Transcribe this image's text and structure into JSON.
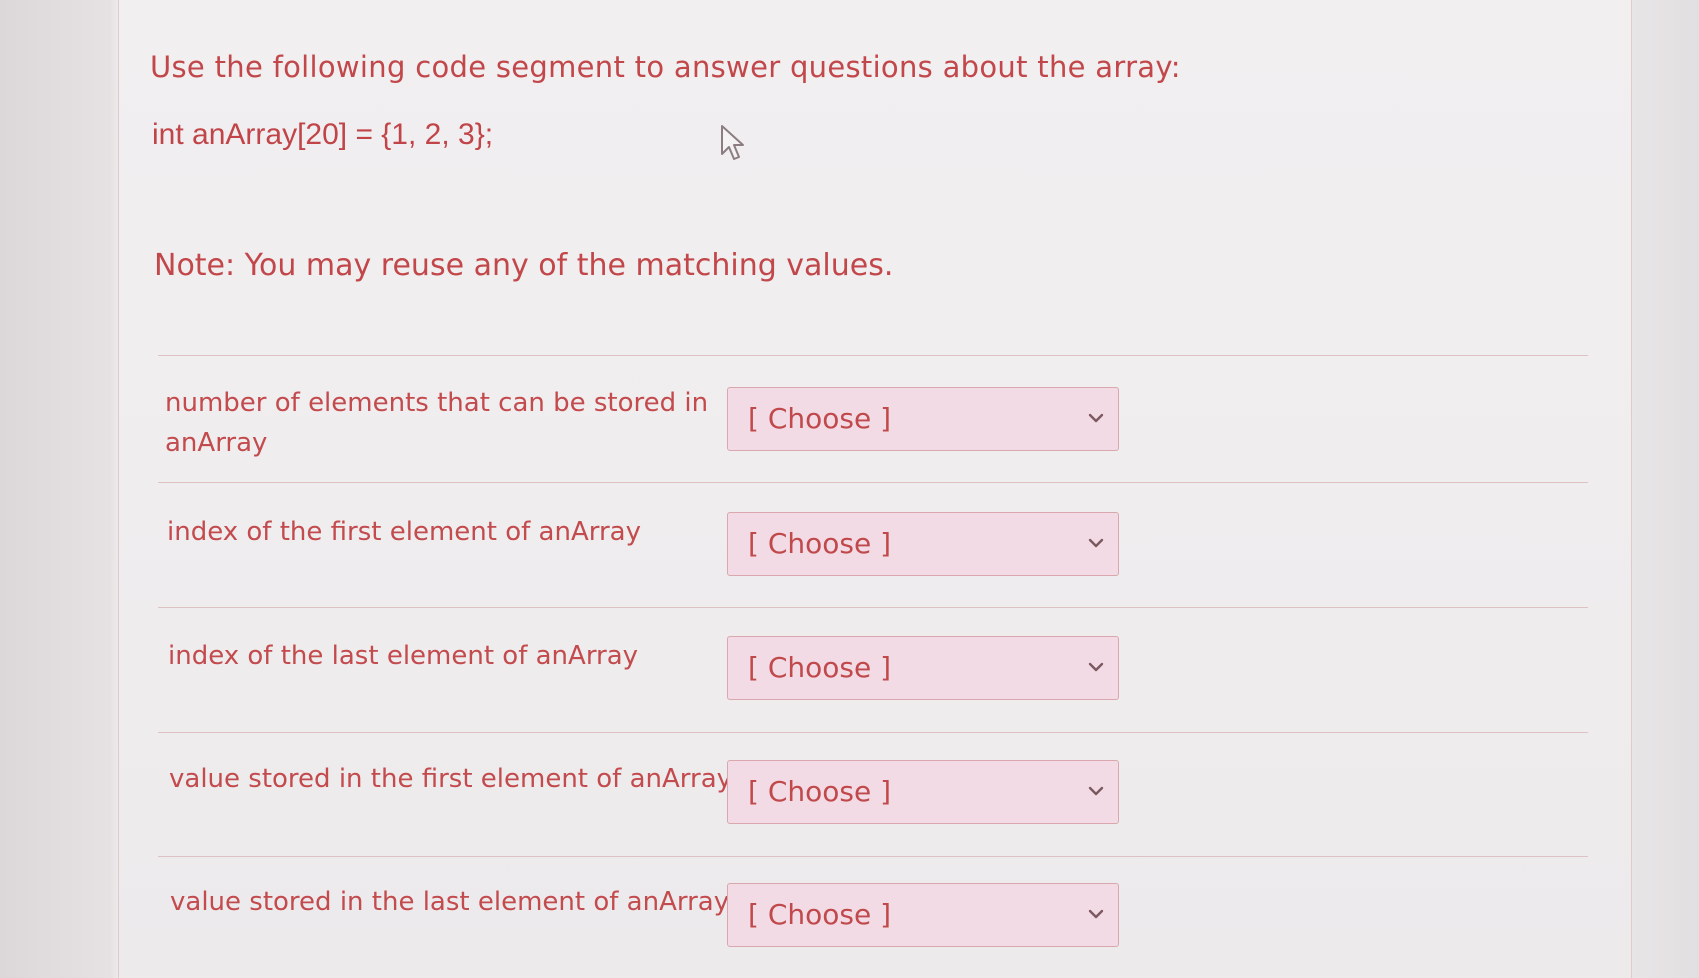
{
  "question": {
    "intro": "Use the following code segment to answer questions about the array:",
    "code": "int anArray[20] = {1, 2, 3};",
    "note": "Note:  You may reuse any of the matching values."
  },
  "matching": [
    {
      "label": "number of elements that can be stored in anArray",
      "selected": "[ Choose ]"
    },
    {
      "label": "index of the first element of anArray",
      "selected": "[ Choose ]"
    },
    {
      "label": "index of the last element of anArray",
      "selected": "[ Choose ]"
    },
    {
      "label": "value stored in the first element of anArray",
      "selected": "[ Choose ]"
    },
    {
      "label": "value stored in the last element of anArray",
      "selected": "[ Choose ]"
    }
  ],
  "colors": {
    "text": "#c2474a",
    "dropdown_bg": "#f3dbe5",
    "dropdown_border": "#d9a7ad",
    "divider": "#dcc2c2"
  },
  "icons": {
    "cursor": "mouse-pointer-icon",
    "dropdown": "chevron-down-icon"
  }
}
